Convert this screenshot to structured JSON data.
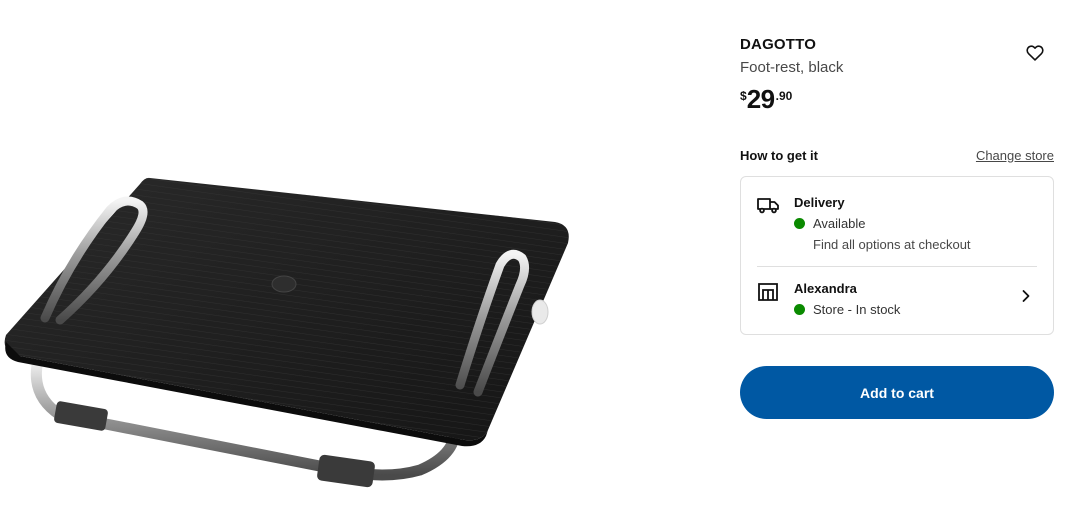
{
  "product": {
    "name": "DAGOTTO",
    "description": "Foot-rest, black",
    "price": {
      "currency": "$",
      "integer": "29",
      "decimal": ".90"
    },
    "image_icon": "foot-rest-product-image"
  },
  "favorite": {
    "icon": "heart-outline-icon"
  },
  "availability": {
    "title": "How to get it",
    "change_store_label": "Change store",
    "delivery": {
      "icon": "delivery-truck-icon",
      "title": "Delivery",
      "status": "Available",
      "status_color": "#0a8a00",
      "note": "Find all options at checkout"
    },
    "store": {
      "icon": "store-icon",
      "name": "Alexandra",
      "status": "Store - In stock",
      "status_color": "#0a8a00"
    }
  },
  "cart": {
    "label": "Add to cart",
    "color": "#0058a3"
  }
}
